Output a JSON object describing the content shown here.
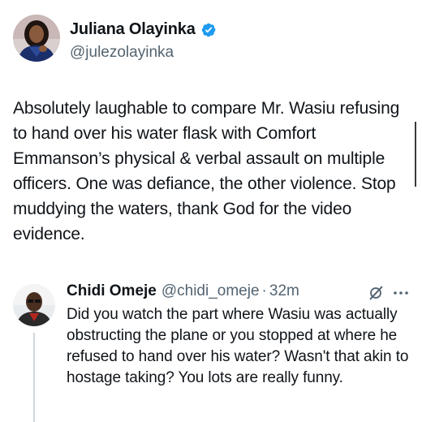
{
  "main_tweet": {
    "author": {
      "display_name": "Juliana Olayinka",
      "handle": "@julezolayinka",
      "verified": true
    },
    "text": "Absolutely laughable to compare Mr. Wasiu refusing to hand over his water flask with Comfort Emmanson’s physical & verbal assault on multiple officers. One was defiance, the other violence. Stop muddying the waters, thank God for the video evidence."
  },
  "reply": {
    "author": {
      "display_name": "Chidi Omeje",
      "handle": "@chidi_omeje"
    },
    "separator": "·",
    "time": "32m",
    "text": "Did you watch the part where Wasiu was actually obstructing the plane or you stopped at where he refused to hand over his water? Wasn't that akin to hostage taking? You lots are really funny."
  },
  "icons": {
    "verified": "verified-badge-icon",
    "grok": "grok-icon",
    "more": "more-options-icon"
  },
  "colors": {
    "verified_blue": "#1d9bf0",
    "text_primary": "#0f1419",
    "text_secondary": "#536471",
    "thread_line": "#cfd9de"
  }
}
